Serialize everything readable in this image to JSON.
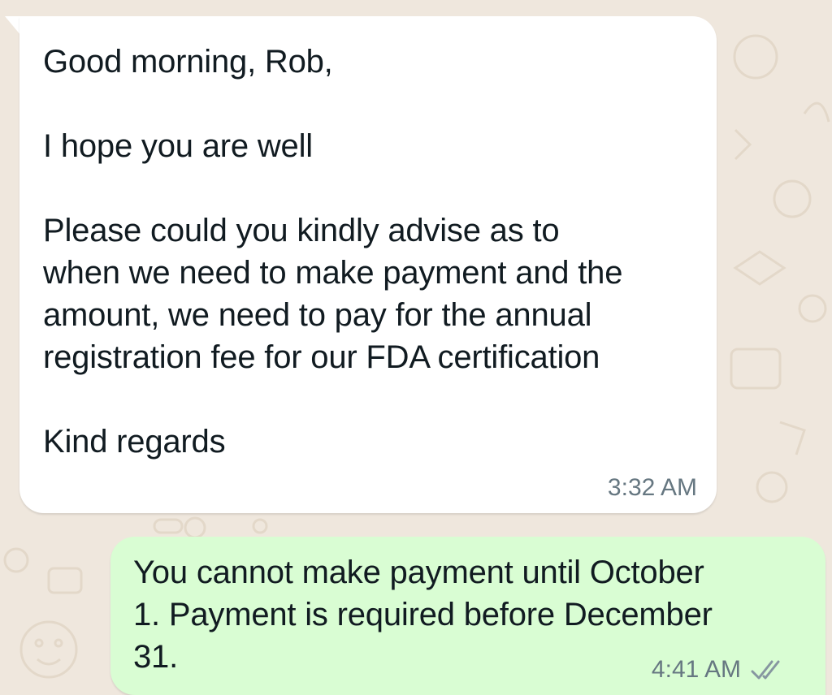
{
  "chat": {
    "incoming": {
      "lines": [
        "Good morning, Rob,",
        "",
        "I hope you are well",
        "",
        "Please could you kindly advise as to",
        "when we need to make payment and the",
        "amount, we need to pay for the annual",
        "registration fee for our FDA certification",
        "",
        "Kind regards"
      ],
      "time": "3:32 AM"
    },
    "outgoing": {
      "lines": [
        "You cannot make payment until October",
        "1. Payment is required before December",
        "31."
      ],
      "time": "4:41 AM",
      "status_icon": "double-check-icon"
    }
  },
  "colors": {
    "wallpaper": "#efe7dd",
    "incoming_bubble": "#ffffff",
    "outgoing_bubble": "#d9fdd3",
    "meta_text": "#667781",
    "text": "#111b21"
  }
}
